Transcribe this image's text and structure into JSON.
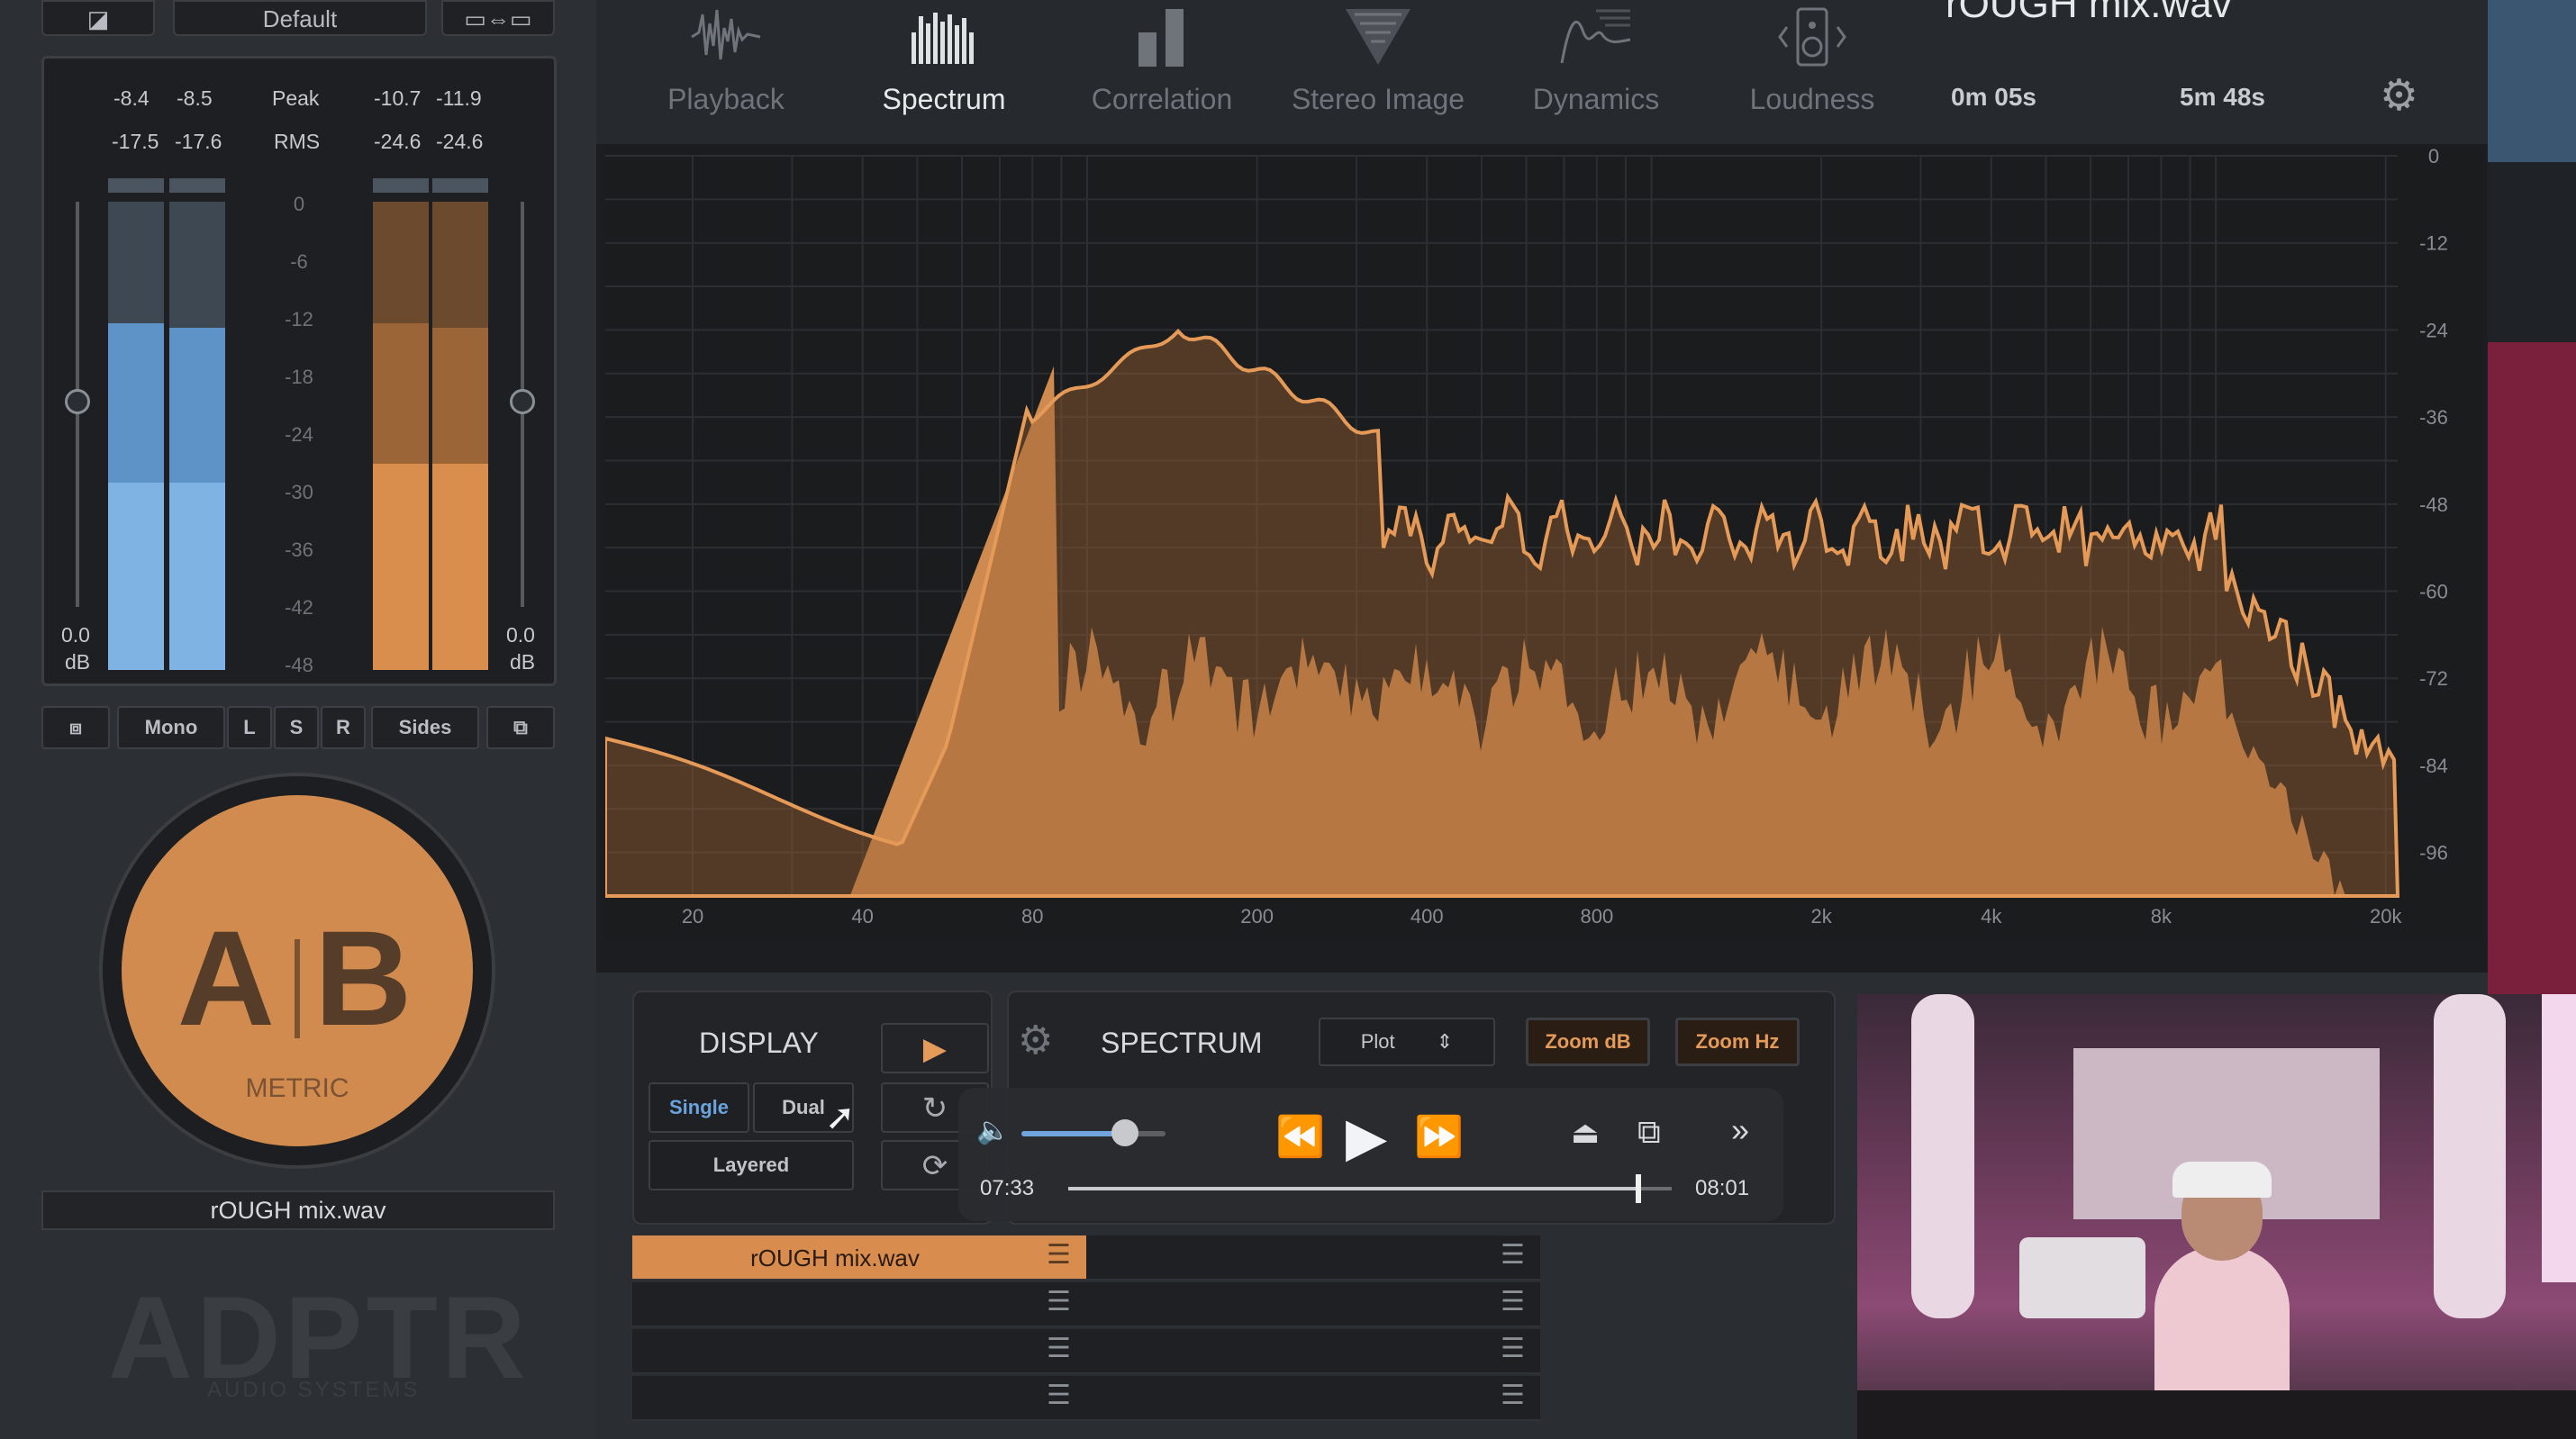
{
  "top_left": {
    "preset_label": "Default"
  },
  "meters": {
    "peak_label": "Peak",
    "rms_label": "RMS",
    "left_peak": [
      "-8.4",
      "-8.5"
    ],
    "left_rms": [
      "-17.5",
      "-17.6"
    ],
    "right_peak": [
      "-10.7",
      "-11.9"
    ],
    "right_rms": [
      "-24.6",
      "-24.6"
    ],
    "scale": [
      "0",
      "-6",
      "-12",
      "-18",
      "-24",
      "-30",
      "-36",
      "-42",
      "-48"
    ],
    "left_gain": "0.0",
    "right_gain": "0.0",
    "gain_unit": "dB",
    "blue_levels": [
      0.74,
      0.73
    ],
    "orange_levels": [
      0.74,
      0.73
    ],
    "blue_rms": [
      0.4,
      0.4
    ],
    "orange_rms": [
      0.44,
      0.44
    ]
  },
  "channel_buttons": {
    "mono": "Mono",
    "l": "L",
    "s": "S",
    "r": "R",
    "sides": "Sides"
  },
  "ab": {
    "a": "A",
    "b": "B",
    "sub": "METRIC"
  },
  "file_label": "rOUGH mix.wav",
  "logo": {
    "name": "ADPTR",
    "sub": "AUDIO SYSTEMS"
  },
  "tabs": [
    {
      "label": "Playback",
      "icon": "waveform-icon",
      "active": false
    },
    {
      "label": "Spectrum",
      "icon": "spectrum-bars-icon",
      "active": true
    },
    {
      "label": "Correlation",
      "icon": "correlation-icon",
      "active": false
    },
    {
      "label": "Stereo Image",
      "icon": "stereo-image-icon",
      "active": false
    },
    {
      "label": "Dynamics",
      "icon": "dynamics-icon",
      "active": false
    },
    {
      "label": "Loudness",
      "icon": "speaker-icon",
      "active": false
    }
  ],
  "header": {
    "file_title": "rOUGH mix.wav",
    "time_current": "0m 05s",
    "time_total": "5m 48s"
  },
  "spectrum": {
    "freq_labels": [
      "20",
      "40",
      "80",
      "200",
      "400",
      "800",
      "2k",
      "4k",
      "8k",
      "20k"
    ],
    "db_labels": [
      "0",
      "-12",
      "-24",
      "-36",
      "-48",
      "-60",
      "-72",
      "-84",
      "-96"
    ]
  },
  "display_panel": {
    "title": "DISPLAY",
    "single": "Single",
    "dual": "Dual",
    "layered": "Layered"
  },
  "spectrum_panel": {
    "title": "SPECTRUM",
    "plot": "Plot",
    "zoom_db": "Zoom dB",
    "zoom_hz": "Zoom Hz"
  },
  "file_list": {
    "active_file": "rOUGH mix.wav"
  },
  "player": {
    "elapsed": "07:33",
    "remaining": "08:01",
    "volume": 0.72,
    "progress": 0.94
  }
}
